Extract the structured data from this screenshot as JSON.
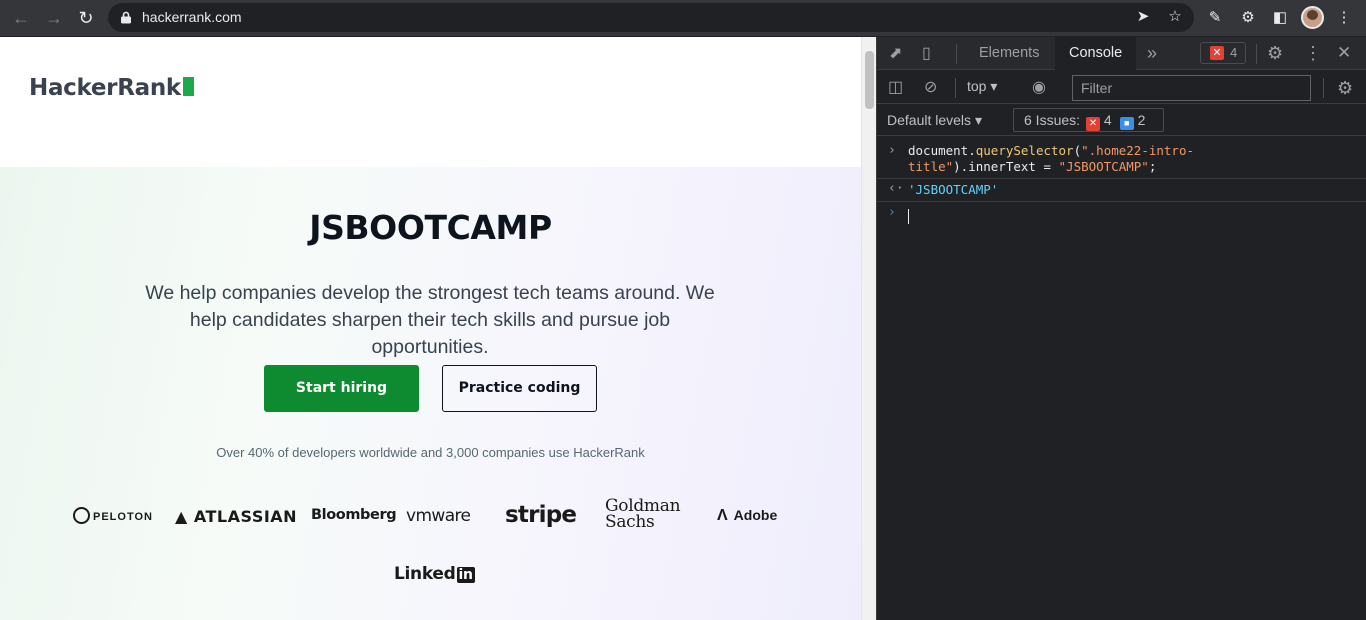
{
  "browser": {
    "url": "hackerrank.com"
  },
  "page": {
    "logo": "HackerRank",
    "hero_title": "JSBOOTCAMP",
    "hero_subtitle": "We help companies develop the strongest tech teams around. We help candidates sharpen their tech skills and pursue job opportunities.",
    "primary_button": "Start hiring",
    "secondary_button": "Practice coding",
    "stat_text": "Over 40% of developers worldwide and 3,000 companies use HackerRank",
    "brands": {
      "peloton": "PELOTON",
      "atlassian": "ATLASSIAN",
      "bloomberg": "Bloomberg",
      "vmware": "vmware",
      "stripe": "stripe",
      "goldman_line1": "Goldman",
      "goldman_line2": "Sachs",
      "adobe": "Adobe",
      "linkedin_word": "Linked",
      "linkedin_in": "in"
    },
    "accent_color": "#1ba94c",
    "button_color": "#0e8a30"
  },
  "devtools": {
    "tabs": [
      "Elements",
      "Console"
    ],
    "active_tab": "Console",
    "error_count": "4",
    "context": "top",
    "filter_placeholder": "Filter",
    "levels": "Default levels",
    "issues_label": "6 Issues:",
    "issues_errors": "4",
    "issues_info": "2",
    "console": {
      "input_obj": "document",
      "input_method": "querySelector",
      "input_arg_line1": "\".home22-intro-",
      "input_arg_line2": "title\"",
      "input_rest": ").innerText = ",
      "input_value": "\"JSBOOTCAMP\"",
      "input_end": ";",
      "result": "'JSBOOTCAMP'"
    }
  }
}
